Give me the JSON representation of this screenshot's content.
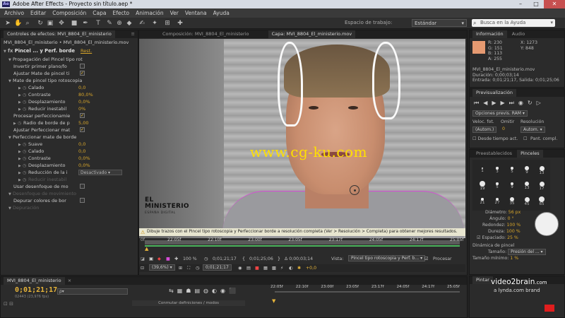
{
  "window": {
    "title": "Adobe After Effects - Proyecto sin título.aep *",
    "app_badge": "Ae"
  },
  "menu": [
    "Archivo",
    "Editar",
    "Composición",
    "Capa",
    "Efecto",
    "Animación",
    "Ver",
    "Ventana",
    "Ayuda"
  ],
  "toolbar": {
    "workspace_label": "Espacio de trabajo:",
    "workspace_value": "Estándar",
    "help_placeholder": "Busca en la Ayuda"
  },
  "effects_panel": {
    "tabs": [
      "Controles de efectos: MVI_8804_El_ministerio"
    ],
    "layer_path": "MVI_8804_El_ministerio • MVI_8804_El_ministerio.mov",
    "effect_name": "Pincel ... y Perf. borde",
    "reset_label": "Rest.",
    "rows": [
      {
        "label": "Propagación del Pincel tipo rot",
        "indent": 1,
        "tri": true
      },
      {
        "label": "Invertir primer plano/fo",
        "indent": 2,
        "check": false
      },
      {
        "label": "Ajustar Mate de pincel ti",
        "indent": 2,
        "check": true
      },
      {
        "label": "Mate de pincel tipo rotoscopia",
        "indent": 1,
        "tri": true
      },
      {
        "label": "Calado",
        "indent": 3,
        "watch": true,
        "value": "0,0"
      },
      {
        "label": "Contraste",
        "indent": 3,
        "watch": true,
        "value": "80,0%"
      },
      {
        "label": "Desplazamiento",
        "indent": 3,
        "watch": true,
        "value": "0,0%"
      },
      {
        "label": "Reducir inestabil",
        "indent": 3,
        "watch": true,
        "value": "0%"
      },
      {
        "label": "Procesar perfeccionamie",
        "indent": 2,
        "check": true
      },
      {
        "label": "Radio de borde de p",
        "indent": 2,
        "watch": true,
        "value": "5,00"
      },
      {
        "label": "Ajustar Perfeccionar mat",
        "indent": 2,
        "check": true
      },
      {
        "label": "Perfeccionar mate de borde",
        "indent": 1,
        "tri": true
      },
      {
        "label": "Suave",
        "indent": 3,
        "watch": true,
        "value": "0,0"
      },
      {
        "label": "Calado",
        "indent": 3,
        "watch": true,
        "value": "0,0"
      },
      {
        "label": "Contraste",
        "indent": 3,
        "watch": true,
        "value": "0,0%"
      },
      {
        "label": "Desplazamiento",
        "indent": 3,
        "watch": true,
        "value": "0,0%"
      },
      {
        "label": "Reducción de la i",
        "indent": 3,
        "watch": true,
        "dropdown": "Desactivado"
      },
      {
        "label": "Reducir inestabil",
        "indent": 3,
        "watch": true,
        "disabled": true
      },
      {
        "label": "Usar desenfoque de mo",
        "indent": 2,
        "check": false
      },
      {
        "label": "Desenfoque de movimiento",
        "indent": 1,
        "tri": true,
        "disabled": true
      },
      {
        "label": "Depurar colores de bor",
        "indent": 2,
        "check": false
      },
      {
        "label": "Depuración",
        "indent": 1,
        "tri": true,
        "disabled": true
      }
    ]
  },
  "viewer": {
    "tabs": [
      "Composición: MVI_8804_El_ministerio",
      "Capa: MVI_8804_El_ministerio.mov"
    ],
    "logo_text": "EL MINISTERIO",
    "logo_sub": "ESPAÑA DIGITAL",
    "watermark": "www.cg-ku.com",
    "hint": "Dibuje trazos con el Pincel tipo rotoscopia y Perfeccionar borde a resolución completa (Ver > Resolución > Completa) para obtener mejores resultados.",
    "ruler_ticks": [
      "22:05f",
      "22:10f",
      "23:00f",
      "23:05f",
      "23:17f",
      "24:05f",
      "24:17f",
      "25:05f"
    ],
    "ruler_start": "0f",
    "controls": {
      "zoom_pct": "100 %",
      "time_cur": "0;01;21;17",
      "time_in": "0;01;21;17",
      "time_out": "0;01;25;06",
      "delta": "Δ 0;00;03;14",
      "view_label": "Vista:",
      "view_value": "Pincel tipo rotoscopia y Perf. b...",
      "render_label": "Procesar",
      "zoom2": "(39,6%)",
      "time2": "0;01;21;17",
      "exposure": "+0,0"
    }
  },
  "info_panel": {
    "tabs": [
      "Información",
      "Audio"
    ],
    "R": "230",
    "G": "151",
    "B": "113",
    "A": "255",
    "X": "1273",
    "Y": "848",
    "swatch_color": "#e69a71",
    "file": "MVI_8804_El_ministerio.mov",
    "duration": "Duración: 0;00;03;14",
    "range": "Entrada: 0;01;21;17, Salida: 0;01;25;06"
  },
  "preview_panel": {
    "title": "Previsualización",
    "options": "Opciones previs. RAM",
    "veloc_label": "Veloc. fot.",
    "omitir_label": "Omitir",
    "res_label": "Resolución",
    "veloc_value": "(Autom.)",
    "omitir_value": "0",
    "res_value": "Autom.",
    "from_label": "Desde tiempo act.",
    "full_label": "Pant. compl."
  },
  "brushes_panel": {
    "tabs": [
      "Preestablecidos",
      "Pinceles"
    ],
    "cells": [
      {
        "n": "1",
        "s": 1
      },
      {
        "n": "3",
        "s": 2
      },
      {
        "n": "5",
        "s": 3
      },
      {
        "n": "9",
        "s": 4
      },
      {
        "n": "13",
        "s": 5
      },
      {
        "n": "19",
        "s": 6
      },
      {
        "n": "5",
        "s": 2
      },
      {
        "n": "9",
        "s": 3
      },
      {
        "n": "13",
        "s": 4
      },
      {
        "n": "17",
        "s": 5
      },
      {
        "n": "21",
        "s": 2
      },
      {
        "n": "27",
        "s": 3
      },
      {
        "n": "35",
        "s": 4
      },
      {
        "n": "45",
        "s": 5
      },
      {
        "n": "65",
        "s": 6
      }
    ],
    "diam_label": "Diámetro:",
    "diam_value": "56 px",
    "angle_label": "Ángulo:",
    "angle_value": "0 °",
    "round_label": "Redondez:",
    "round_value": "100 %",
    "hard_label": "Dureza:",
    "hard_value": "100 %",
    "spacing_label": "Espaciado:",
    "spacing_value": "25 %",
    "dyn_label": "Dinámica de pincel",
    "size_label": "Tamaño:",
    "size_value": "Presión del ...",
    "min_label": "Tamaño mínimo:",
    "min_value": "1 %"
  },
  "timeline": {
    "tab": "MVI_8804_El_ministerio",
    "current_time": "0;01;21;17",
    "fps_text": "02443 (23,976 fps)",
    "search_placeholder": "ρ▾",
    "switch_label": "Conmutar definiciones / modos",
    "ticks": [
      "22:05f",
      "22:10f",
      "23:00f",
      "23:05f",
      "23:17f",
      "24:05f",
      "24:17f",
      "25:05f"
    ],
    "paint_tab": "Pintar",
    "brand1": "video2brain",
    "brand2": ".com",
    "brand3": "a lynda.com brand"
  },
  "colors": {
    "accent": "#e6b43a",
    "value": "#d7a52a",
    "green": "#4bb45c",
    "mask": "#d64cd6"
  }
}
